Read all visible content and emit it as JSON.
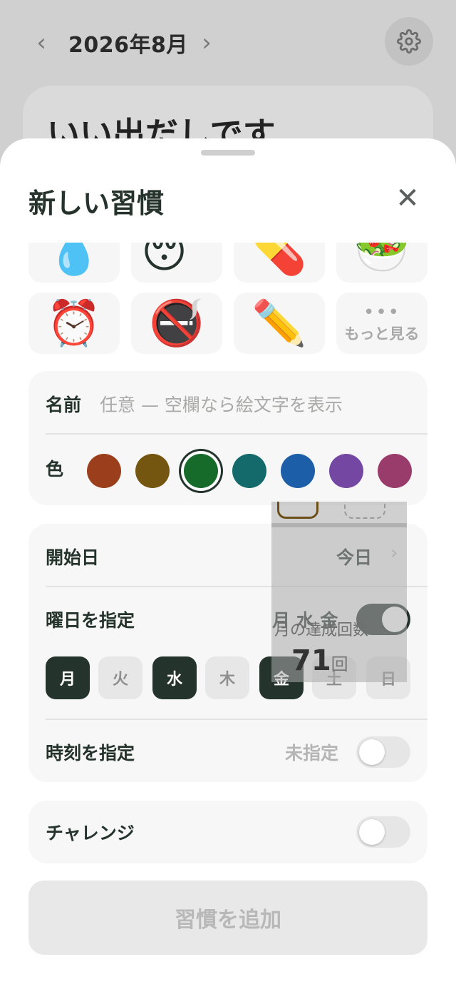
{
  "background": {
    "month_title": "2026年8月",
    "prev_icon": "chevron-left-icon",
    "next_icon": "chevron-right-icon",
    "settings_icon": "gear-icon",
    "card_text": "いい出だしです"
  },
  "sheet": {
    "title": "新しい習慣",
    "close_icon": "close-icon",
    "emojis_row1": [
      "💧",
      "😴",
      "💊",
      "🥗"
    ],
    "emojis_row2": [
      "⏰",
      "🚭",
      "✏️"
    ],
    "more_label": "もっと見る",
    "name_label": "名前",
    "name_placeholder": "任意 — 空欄なら絵文字を表示",
    "color_label": "色",
    "colors": [
      "#9b3e1c",
      "#755610",
      "#166a2a",
      "#14696a",
      "#1d5ea8",
      "#7448a2",
      "#9a3c6b"
    ],
    "selected_color_index": 2,
    "start_date_label": "開始日",
    "start_date_value": "今日",
    "weekday_label": "曜日を指定",
    "weekday_summary": "月 水 金",
    "weekday_enabled": true,
    "days": [
      "月",
      "火",
      "水",
      "木",
      "金",
      "土",
      "日"
    ],
    "days_selected": [
      true,
      false,
      true,
      false,
      true,
      false,
      false
    ],
    "time_label": "時刻を指定",
    "time_value": "未指定",
    "time_enabled": false,
    "challenge_label": "チャレンジ",
    "challenge_enabled": false,
    "add_button": "習慣を追加"
  },
  "ghost": {
    "label": "月の達成回数",
    "count": "71",
    "count_unit": "回"
  }
}
